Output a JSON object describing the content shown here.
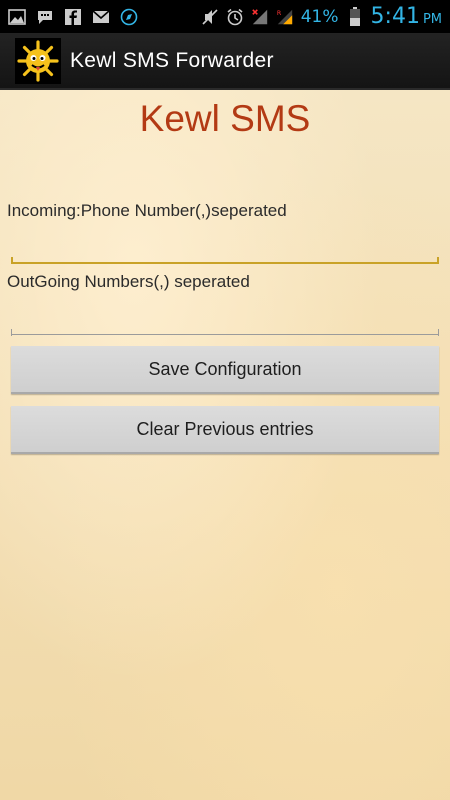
{
  "status_bar": {
    "battery_percent": "41%",
    "time": "5:41",
    "ampm": "PM",
    "accent_color": "#33b5e5",
    "icons_left": [
      "gallery-icon",
      "chat-icon",
      "facebook-icon",
      "mail-icon",
      "compass-icon"
    ],
    "icons_right": [
      "mute-icon",
      "alarm-icon",
      "signal-no-sim-icon",
      "signal-roaming-icon",
      "battery-icon"
    ]
  },
  "action_bar": {
    "title": "Kewl SMS Forwarder"
  },
  "main": {
    "heading": "Kewl SMS",
    "heading_color": "#b33a14",
    "incoming_label": "Incoming:Phone Number(,)seperated",
    "incoming_value": "",
    "outgoing_label": "OutGoing Numbers(,) seperated",
    "outgoing_value": "",
    "save_button": "Save Configuration",
    "clear_button": "Clear Previous entries"
  }
}
